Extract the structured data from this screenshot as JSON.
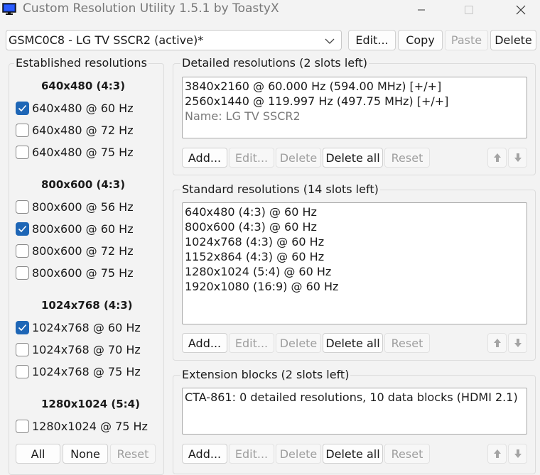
{
  "window": {
    "title": "Custom Resolution Utility 1.5.1 by ToastyX"
  },
  "toolbar": {
    "monitor_selected": "GSMC0C8 - LG TV SSCR2 (active)*",
    "edit_label": "Edit...",
    "copy_label": "Copy",
    "paste_label": "Paste",
    "delete_label": "Delete"
  },
  "established": {
    "title": "Established resolutions",
    "groups": [
      {
        "header": "640x480 (4:3)",
        "items": [
          {
            "label": "640x480 @ 60 Hz",
            "checked": true
          },
          {
            "label": "640x480 @ 72 Hz",
            "checked": false
          },
          {
            "label": "640x480 @ 75 Hz",
            "checked": false
          }
        ]
      },
      {
        "header": "800x600 (4:3)",
        "items": [
          {
            "label": "800x600 @ 56 Hz",
            "checked": false
          },
          {
            "label": "800x600 @ 60 Hz",
            "checked": true
          },
          {
            "label": "800x600 @ 72 Hz",
            "checked": false
          },
          {
            "label": "800x600 @ 75 Hz",
            "checked": false
          }
        ]
      },
      {
        "header": "1024x768 (4:3)",
        "items": [
          {
            "label": "1024x768 @ 60 Hz",
            "checked": true
          },
          {
            "label": "1024x768 @ 70 Hz",
            "checked": false
          },
          {
            "label": "1024x768 @ 75 Hz",
            "checked": false
          }
        ]
      },
      {
        "header": "1280x1024 (5:4)",
        "items": [
          {
            "label": "1280x1024 @ 75 Hz",
            "checked": false
          }
        ]
      }
    ],
    "all_label": "All",
    "none_label": "None",
    "reset_label": "Reset"
  },
  "detailed": {
    "title": "Detailed resolutions (2 slots left)",
    "rows": [
      "3840x2160 @ 60.000 Hz (594.00 MHz) [+/+]",
      "2560x1440 @ 119.997 Hz (497.75 MHz) [+/+]"
    ],
    "name_row": "Name: LG TV SSCR2",
    "buttons": {
      "add": "Add...",
      "edit": "Edit...",
      "delete": "Delete",
      "delete_all": "Delete all",
      "reset": "Reset"
    }
  },
  "standard": {
    "title": "Standard resolutions (14 slots left)",
    "rows": [
      "640x480 (4:3) @ 60 Hz",
      "800x600 (4:3) @ 60 Hz",
      "1024x768 (4:3) @ 60 Hz",
      "1152x864 (4:3) @ 60 Hz",
      "1280x1024 (5:4) @ 60 Hz",
      "1920x1080 (16:9) @ 60 Hz"
    ],
    "buttons": {
      "add": "Add...",
      "edit": "Edit...",
      "delete": "Delete",
      "delete_all": "Delete all",
      "reset": "Reset"
    }
  },
  "extension": {
    "title": "Extension blocks (2 slots left)",
    "rows": [
      "CTA-861: 0 detailed resolutions, 10 data blocks (HDMI 2.1)"
    ],
    "buttons": {
      "add": "Add...",
      "edit": "Edit...",
      "delete": "Delete",
      "delete_all": "Delete all",
      "reset": "Reset"
    }
  },
  "colors": {
    "accent": "#1e66b6",
    "window_bg": "#f3f3f3",
    "disabled_text": "#9e9e9e"
  },
  "icons": {
    "app": "monitor-icon",
    "minimize": "minimize-icon",
    "maximize": "maximize-icon",
    "close": "close-icon",
    "dropdown": "chevron-down-icon",
    "move_up": "arrow-up-icon",
    "move_down": "arrow-down-icon",
    "check": "checkmark-icon"
  }
}
